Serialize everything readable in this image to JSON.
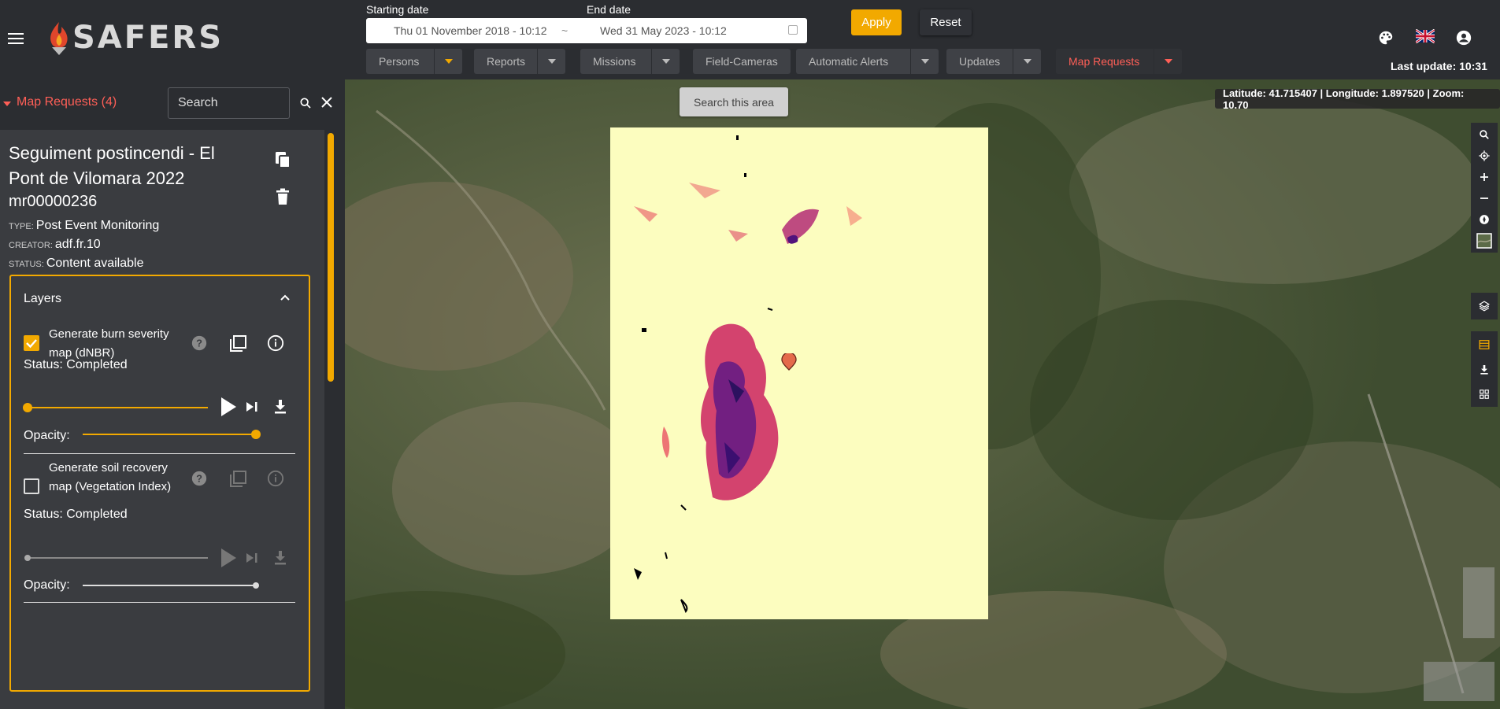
{
  "header": {
    "app_name": "SAFERS",
    "starting_date_label": "Starting date",
    "end_date_label": "End date",
    "start_value": "Thu 01 November 2018 - 10:12",
    "separator": "~",
    "end_value": "Wed 31 May 2023 - 10:12",
    "apply_label": "Apply",
    "reset_label": "Reset",
    "last_update": "Last update: 10:31",
    "tabs": [
      {
        "label": "Persons",
        "has_dropdown": true
      },
      {
        "label": "Reports",
        "has_dropdown": true
      },
      {
        "label": "Missions",
        "has_dropdown": true
      },
      {
        "label": "Field-Cameras",
        "has_dropdown": false
      },
      {
        "label": "Automatic Alerts",
        "has_dropdown": true
      },
      {
        "label": "Updates",
        "has_dropdown": true
      },
      {
        "label": "Map Requests",
        "has_dropdown": true,
        "active": true
      }
    ]
  },
  "sidebar": {
    "section_title": "Map Requests (4)",
    "search_placeholder": "Search",
    "request": {
      "title": "Seguiment postincendi - El Pont de Vilomara 2022",
      "code": "mr00000236",
      "type_key": "Type:",
      "type_value": "Post Event Monitoring",
      "creator_key": "Creator:",
      "creator_value": "adf.fr.10",
      "status_key": "Status:",
      "status_value": "Content available"
    },
    "layers": {
      "title": "Layers",
      "items": [
        {
          "name": "Generate burn severity map (dNBR)",
          "status": "Status: Completed",
          "checked": true,
          "opacity_label": "Opacity:",
          "opacity": 0.9,
          "timeline": 0
        },
        {
          "name": "Generate soil recovery map (Vegetation Index)",
          "status": "Status: Completed",
          "checked": false,
          "opacity_label": "Opacity:",
          "opacity": 0.9,
          "timeline": 0
        }
      ]
    }
  },
  "map": {
    "search_area_label": "Search this area",
    "coords_readout": "Latitude: 41.715407 | Longitude: 1.897520 | Zoom: 10.70"
  },
  "colors": {
    "accent": "#f2a900",
    "active_tab": "#ff5f57",
    "background": "#2b2d31"
  }
}
